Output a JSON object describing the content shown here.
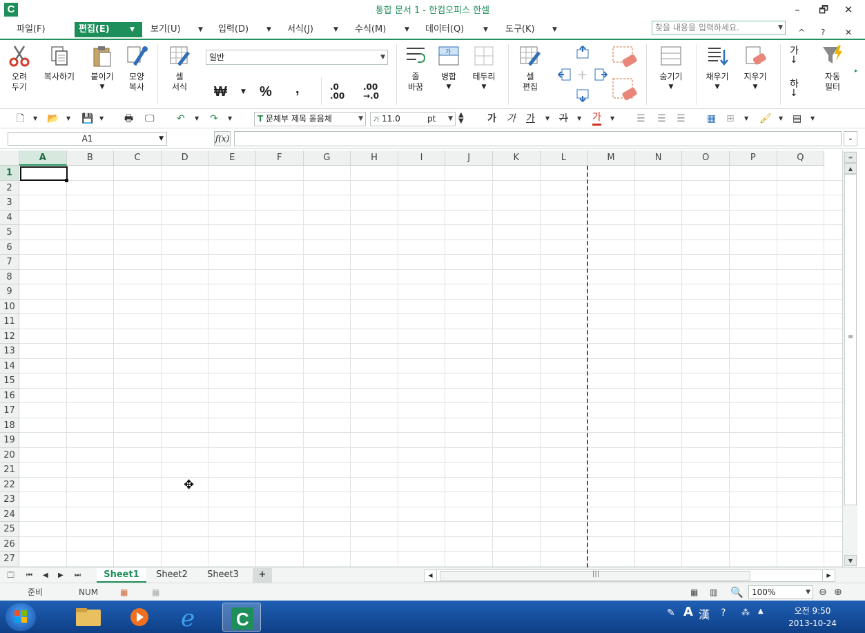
{
  "app": {
    "logo_letter": "C",
    "title": "통합 문서 1 - 한컴오피스 한셀",
    "window_controls": {
      "minimize": "–",
      "restore": "🗗",
      "close": "✕"
    }
  },
  "menubar": {
    "items": [
      {
        "label": "파일(F)"
      },
      {
        "label": "편집(E)",
        "active": true
      },
      {
        "label": "보기(U)"
      },
      {
        "label": "입력(D)"
      },
      {
        "label": "서식(J)"
      },
      {
        "label": "수식(M)"
      },
      {
        "label": "데이터(Q)"
      },
      {
        "label": "도구(K)"
      }
    ],
    "search_placeholder": "찾을 내용을 입력하세요.",
    "right_controls": [
      "^",
      "?",
      "✕"
    ]
  },
  "ribbon": {
    "cut": "오려\n두기",
    "copy": "복사하기",
    "paste": "붙이기",
    "format_painter": "모양\n복사",
    "cell_format": "셀\n서식",
    "number_format": "일반",
    "currency": "₩",
    "percent": "%",
    "comma": ",",
    "dec_increase": ".0\n.00",
    "dec_decrease": ".00\n→.0",
    "wrap": "줄\n바꿈",
    "merge": "병합",
    "border": "테두리",
    "cell_edit": "셀\n편집",
    "hide": "숨기기",
    "fill": "채우기",
    "clear": "지우기",
    "sort_asc": "가\n↓",
    "sort_desc": "하\n↓",
    "autofilter": "자동\n필터"
  },
  "toolbar2": {
    "font_name": "문체부 제목 돋음체",
    "font_size": "11.0",
    "font_unit": "pt",
    "bold": "가",
    "italic": "가",
    "underline": "가",
    "strike": "가",
    "font_color": "가"
  },
  "formula": {
    "cell_ref": "A1",
    "fx_label": "f(x)",
    "content": ""
  },
  "grid": {
    "columns": [
      "A",
      "B",
      "C",
      "D",
      "E",
      "F",
      "G",
      "H",
      "I",
      "J",
      "K",
      "L",
      "M",
      "N",
      "O",
      "P",
      "Q"
    ],
    "rows": [
      "1",
      "2",
      "3",
      "4",
      "5",
      "6",
      "7",
      "8",
      "9",
      "10",
      "11",
      "12",
      "13",
      "14",
      "15",
      "16",
      "17",
      "18",
      "19",
      "20",
      "21",
      "22",
      "23",
      "24",
      "25",
      "26",
      "27"
    ],
    "selected_cell": "A1"
  },
  "sheets": {
    "tabs": [
      "Sheet1",
      "Sheet2",
      "Sheet3"
    ],
    "active": "Sheet1",
    "add_label": "+"
  },
  "status": {
    "mode": "준비",
    "num": "NUM",
    "zoom": "100%"
  },
  "taskbar": {
    "lang_a": "A",
    "lang_hanja": "漢",
    "clock_time": "오전 9:50",
    "clock_date": "2013-10-24"
  }
}
